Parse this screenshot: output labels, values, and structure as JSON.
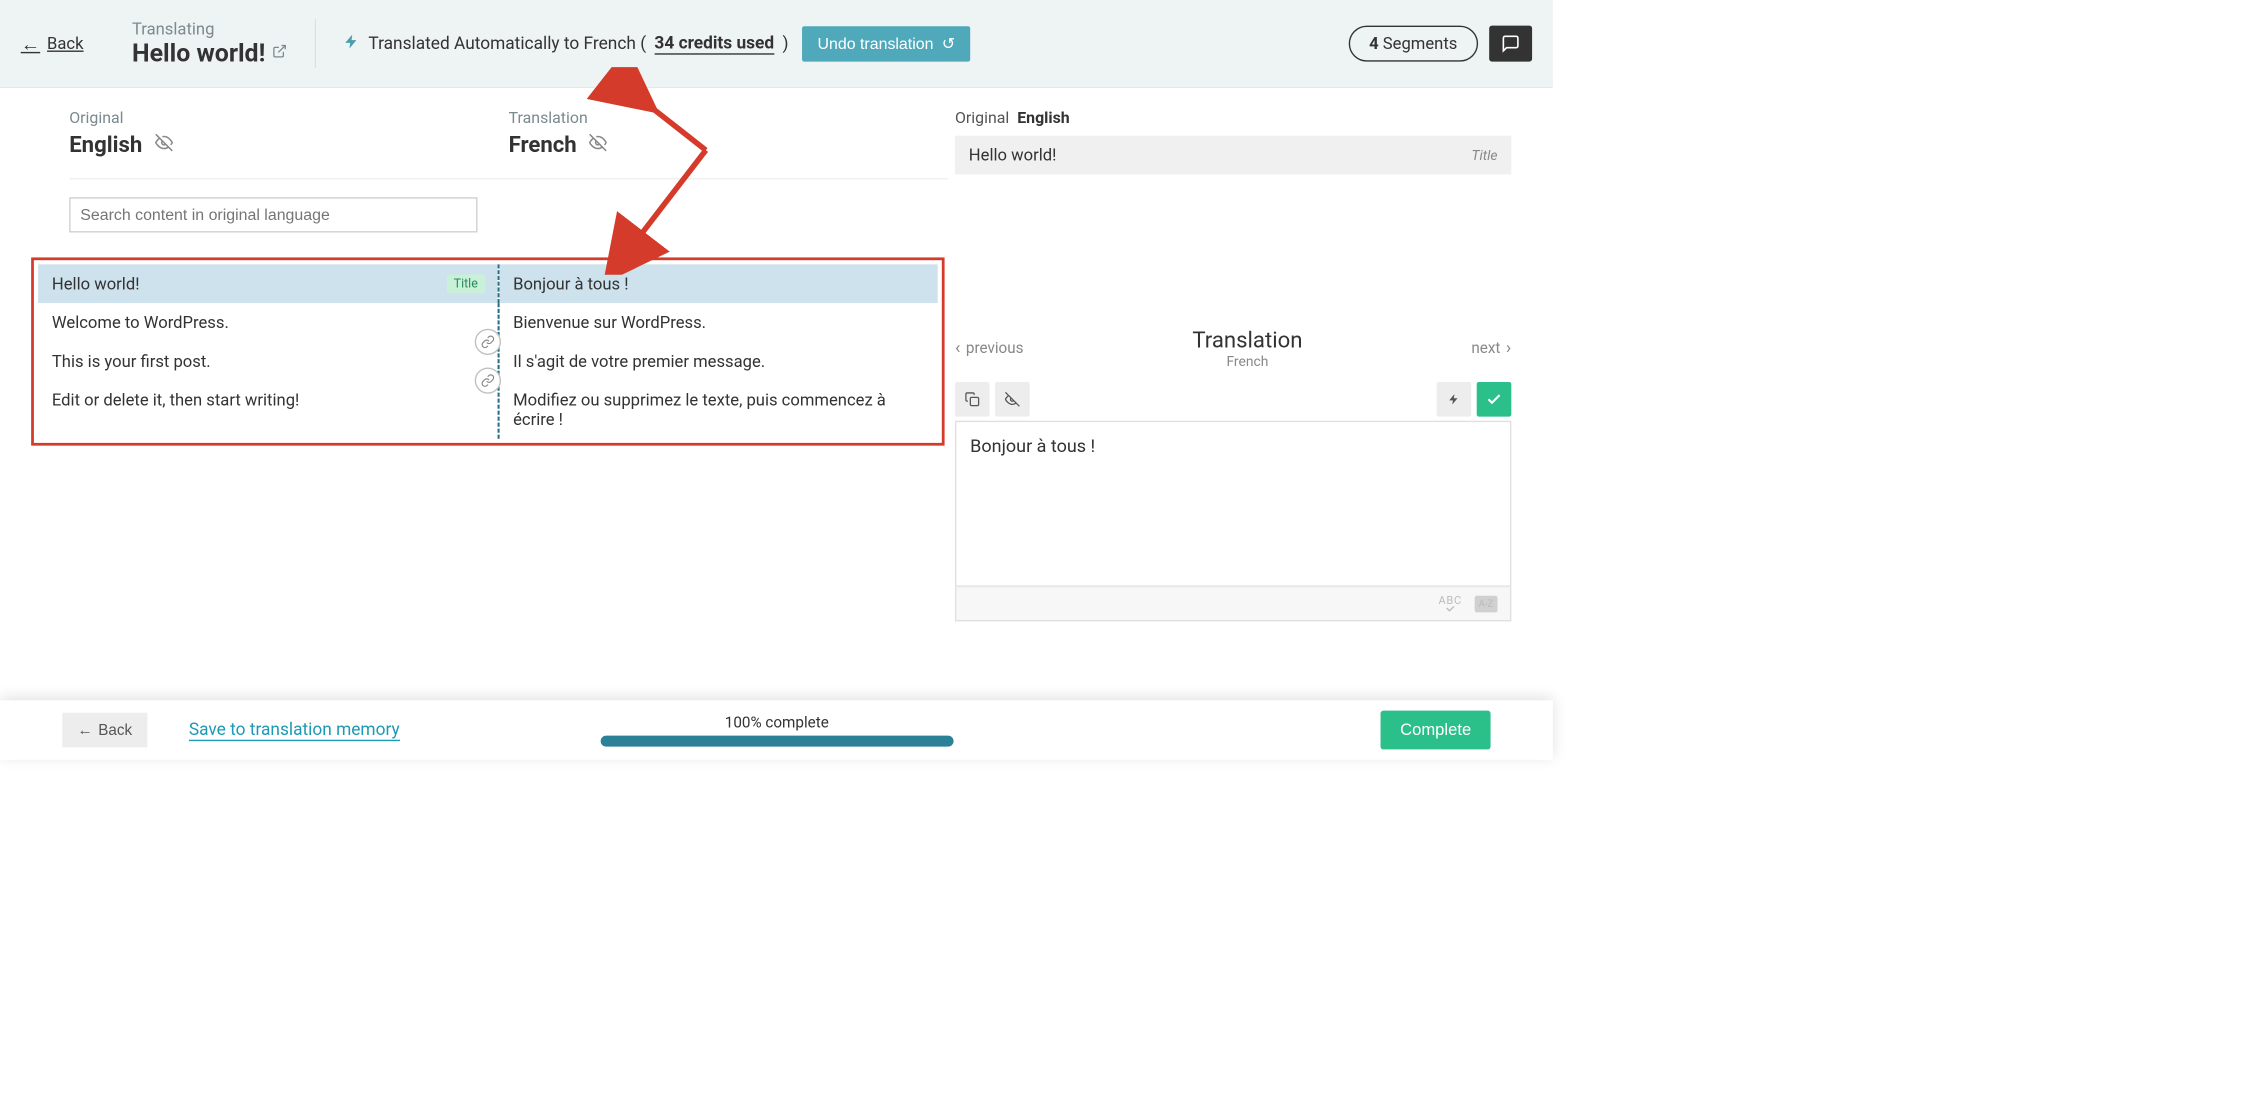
{
  "header": {
    "back": "Back",
    "overline": "Translating",
    "title": "Hello world!",
    "auto_msg_prefix": "Translated Automatically to French (",
    "credits": "34 credits used",
    "auto_msg_suffix": ")",
    "undo": "Undo translation",
    "segments_count": "4",
    "segments_label": "Segments"
  },
  "left": {
    "original_label": "Original",
    "original_lang": "English",
    "translation_label": "Translation",
    "translation_lang": "French",
    "search_placeholder": "Search content in original language",
    "segments": [
      {
        "orig": "Hello world!",
        "trans": "Bonjour à tous !",
        "title_badge": "Title",
        "selected": true
      },
      {
        "orig": "Welcome to WordPress.",
        "trans": "Bienvenue sur WordPress."
      },
      {
        "orig": "This is your first post.",
        "trans": "Il s'agit de votre premier message."
      },
      {
        "orig": "Edit or delete it, then start writing!",
        "trans": "Modifiez ou supprimez le texte, puis commencez à écrire !"
      }
    ]
  },
  "right": {
    "original_label": "Original",
    "original_lang": "English",
    "original_text": "Hello world!",
    "title_tag": "Title",
    "translation_heading": "Translation",
    "translation_lang": "French",
    "prev": "previous",
    "next": "next",
    "translation_text": "Bonjour à tous !"
  },
  "footer": {
    "back": "Back",
    "save_mem": "Save to translation memory",
    "progress": "100% complete",
    "complete": "Complete"
  }
}
